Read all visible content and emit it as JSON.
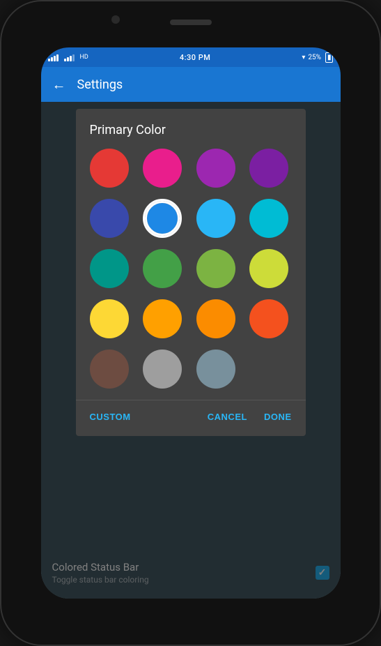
{
  "phone": {
    "status_bar": {
      "time": "4:30 PM",
      "battery": "25%",
      "wifi": "WiFi"
    },
    "app_bar": {
      "back_label": "←",
      "title": "Settings"
    },
    "dialog": {
      "title": "Primary Color",
      "colors": [
        {
          "id": "red",
          "hex": "#e53935",
          "selected": false
        },
        {
          "id": "pink",
          "hex": "#e91e8c",
          "selected": false
        },
        {
          "id": "purple-mid",
          "hex": "#9c27b0",
          "selected": false
        },
        {
          "id": "purple-dark",
          "hex": "#7b1fa2",
          "selected": false
        },
        {
          "id": "indigo",
          "hex": "#3949ab",
          "selected": false
        },
        {
          "id": "blue-light",
          "hex": "#1e88e5",
          "selected": true
        },
        {
          "id": "blue",
          "hex": "#29b6f6",
          "selected": false
        },
        {
          "id": "cyan",
          "hex": "#00bcd4",
          "selected": false
        },
        {
          "id": "teal",
          "hex": "#009688",
          "selected": false
        },
        {
          "id": "green",
          "hex": "#43a047",
          "selected": false
        },
        {
          "id": "light-green",
          "hex": "#7cb342",
          "selected": false
        },
        {
          "id": "yellow-green",
          "hex": "#cddc39",
          "selected": false
        },
        {
          "id": "yellow",
          "hex": "#fdd835",
          "selected": false
        },
        {
          "id": "amber",
          "hex": "#ffa000",
          "selected": false
        },
        {
          "id": "orange",
          "hex": "#fb8c00",
          "selected": false
        },
        {
          "id": "deep-orange",
          "hex": "#f4511e",
          "selected": false
        },
        {
          "id": "brown",
          "hex": "#6d4c41",
          "selected": false
        },
        {
          "id": "grey-light",
          "hex": "#9e9e9e",
          "selected": false
        },
        {
          "id": "grey-blue",
          "hex": "#78909c",
          "selected": false
        }
      ],
      "buttons": {
        "custom": "CUSTOM",
        "cancel": "CANCEL",
        "done": "DONE"
      }
    },
    "settings": {
      "colored_status_bar": {
        "title": "Colored Status Bar",
        "subtitle": "Toggle status bar coloring",
        "checked": true
      }
    }
  }
}
